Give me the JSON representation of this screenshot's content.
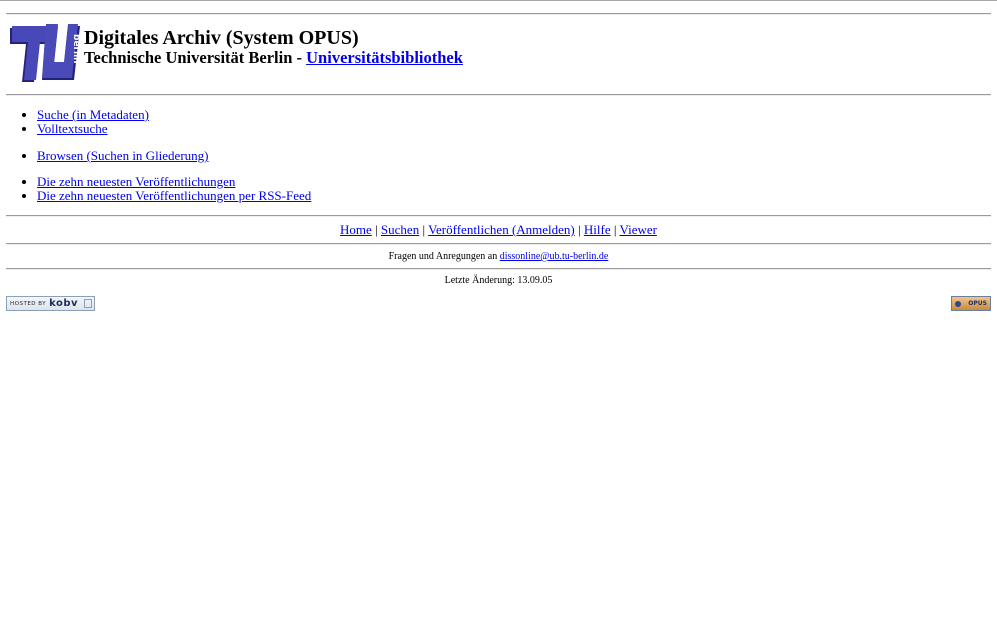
{
  "header": {
    "title": "Digitales Archiv (System OPUS)",
    "subtitle_prefix": "Technische Universität Berlin - ",
    "library_link": "Universitätsbibliothek",
    "logo_text": "berlin"
  },
  "menu": {
    "group1": [
      "Suche (in Metadaten)",
      "Volltextsuche"
    ],
    "group2": [
      "Browsen (Suchen in Gliederung)"
    ],
    "group3": [
      "Die zehn neuesten Veröffentlichungen",
      "Die zehn neuesten Veröffentlichungen per RSS-Feed"
    ]
  },
  "nav": {
    "home": "Home",
    "search": "Suchen",
    "publish": "Veröffentlichen (Anmelden)",
    "help": "Hilfe",
    "viewer": "Viewer",
    "separator": "|"
  },
  "footer": {
    "contact_prefix": "Fragen und Anregungen an ",
    "contact_email": "dissonline@ub.tu-berlin.de",
    "last_changed": "Letzte Änderung: 13.09.05",
    "kobv_small": "HOSTED BY",
    "kobv_big": "kobv",
    "opus_badge": "OPUS"
  },
  "colors": {
    "link": "#0000ee",
    "rule": "#9a9a9a",
    "logo_blue": "#3e3fa8"
  }
}
